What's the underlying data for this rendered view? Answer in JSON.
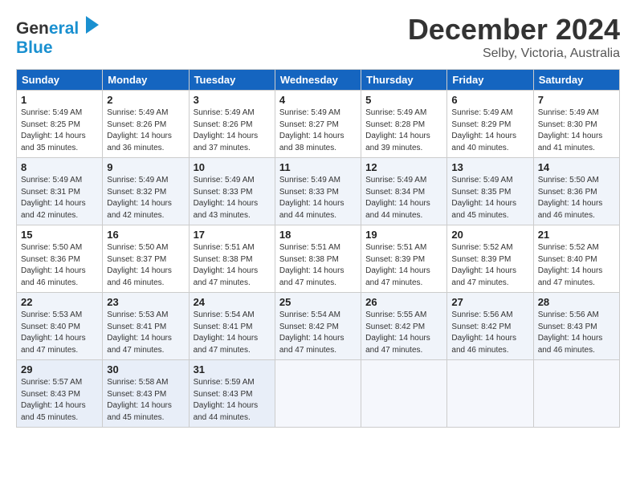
{
  "header": {
    "logo_line1": "General",
    "logo_line2": "Blue",
    "title": "December 2024",
    "subtitle": "Selby, Victoria, Australia"
  },
  "calendar": {
    "days_of_week": [
      "Sunday",
      "Monday",
      "Tuesday",
      "Wednesday",
      "Thursday",
      "Friday",
      "Saturday"
    ],
    "weeks": [
      [
        {
          "day": "1",
          "sunrise": "Sunrise: 5:49 AM",
          "sunset": "Sunset: 8:25 PM",
          "daylight": "Daylight: 14 hours and 35 minutes."
        },
        {
          "day": "2",
          "sunrise": "Sunrise: 5:49 AM",
          "sunset": "Sunset: 8:26 PM",
          "daylight": "Daylight: 14 hours and 36 minutes."
        },
        {
          "day": "3",
          "sunrise": "Sunrise: 5:49 AM",
          "sunset": "Sunset: 8:26 PM",
          "daylight": "Daylight: 14 hours and 37 minutes."
        },
        {
          "day": "4",
          "sunrise": "Sunrise: 5:49 AM",
          "sunset": "Sunset: 8:27 PM",
          "daylight": "Daylight: 14 hours and 38 minutes."
        },
        {
          "day": "5",
          "sunrise": "Sunrise: 5:49 AM",
          "sunset": "Sunset: 8:28 PM",
          "daylight": "Daylight: 14 hours and 39 minutes."
        },
        {
          "day": "6",
          "sunrise": "Sunrise: 5:49 AM",
          "sunset": "Sunset: 8:29 PM",
          "daylight": "Daylight: 14 hours and 40 minutes."
        },
        {
          "day": "7",
          "sunrise": "Sunrise: 5:49 AM",
          "sunset": "Sunset: 8:30 PM",
          "daylight": "Daylight: 14 hours and 41 minutes."
        }
      ],
      [
        {
          "day": "8",
          "sunrise": "Sunrise: 5:49 AM",
          "sunset": "Sunset: 8:31 PM",
          "daylight": "Daylight: 14 hours and 42 minutes."
        },
        {
          "day": "9",
          "sunrise": "Sunrise: 5:49 AM",
          "sunset": "Sunset: 8:32 PM",
          "daylight": "Daylight: 14 hours and 42 minutes."
        },
        {
          "day": "10",
          "sunrise": "Sunrise: 5:49 AM",
          "sunset": "Sunset: 8:33 PM",
          "daylight": "Daylight: 14 hours and 43 minutes."
        },
        {
          "day": "11",
          "sunrise": "Sunrise: 5:49 AM",
          "sunset": "Sunset: 8:33 PM",
          "daylight": "Daylight: 14 hours and 44 minutes."
        },
        {
          "day": "12",
          "sunrise": "Sunrise: 5:49 AM",
          "sunset": "Sunset: 8:34 PM",
          "daylight": "Daylight: 14 hours and 44 minutes."
        },
        {
          "day": "13",
          "sunrise": "Sunrise: 5:49 AM",
          "sunset": "Sunset: 8:35 PM",
          "daylight": "Daylight: 14 hours and 45 minutes."
        },
        {
          "day": "14",
          "sunrise": "Sunrise: 5:50 AM",
          "sunset": "Sunset: 8:36 PM",
          "daylight": "Daylight: 14 hours and 46 minutes."
        }
      ],
      [
        {
          "day": "15",
          "sunrise": "Sunrise: 5:50 AM",
          "sunset": "Sunset: 8:36 PM",
          "daylight": "Daylight: 14 hours and 46 minutes."
        },
        {
          "day": "16",
          "sunrise": "Sunrise: 5:50 AM",
          "sunset": "Sunset: 8:37 PM",
          "daylight": "Daylight: 14 hours and 46 minutes."
        },
        {
          "day": "17",
          "sunrise": "Sunrise: 5:51 AM",
          "sunset": "Sunset: 8:38 PM",
          "daylight": "Daylight: 14 hours and 47 minutes."
        },
        {
          "day": "18",
          "sunrise": "Sunrise: 5:51 AM",
          "sunset": "Sunset: 8:38 PM",
          "daylight": "Daylight: 14 hours and 47 minutes."
        },
        {
          "day": "19",
          "sunrise": "Sunrise: 5:51 AM",
          "sunset": "Sunset: 8:39 PM",
          "daylight": "Daylight: 14 hours and 47 minutes."
        },
        {
          "day": "20",
          "sunrise": "Sunrise: 5:52 AM",
          "sunset": "Sunset: 8:39 PM",
          "daylight": "Daylight: 14 hours and 47 minutes."
        },
        {
          "day": "21",
          "sunrise": "Sunrise: 5:52 AM",
          "sunset": "Sunset: 8:40 PM",
          "daylight": "Daylight: 14 hours and 47 minutes."
        }
      ],
      [
        {
          "day": "22",
          "sunrise": "Sunrise: 5:53 AM",
          "sunset": "Sunset: 8:40 PM",
          "daylight": "Daylight: 14 hours and 47 minutes."
        },
        {
          "day": "23",
          "sunrise": "Sunrise: 5:53 AM",
          "sunset": "Sunset: 8:41 PM",
          "daylight": "Daylight: 14 hours and 47 minutes."
        },
        {
          "day": "24",
          "sunrise": "Sunrise: 5:54 AM",
          "sunset": "Sunset: 8:41 PM",
          "daylight": "Daylight: 14 hours and 47 minutes."
        },
        {
          "day": "25",
          "sunrise": "Sunrise: 5:54 AM",
          "sunset": "Sunset: 8:42 PM",
          "daylight": "Daylight: 14 hours and 47 minutes."
        },
        {
          "day": "26",
          "sunrise": "Sunrise: 5:55 AM",
          "sunset": "Sunset: 8:42 PM",
          "daylight": "Daylight: 14 hours and 47 minutes."
        },
        {
          "day": "27",
          "sunrise": "Sunrise: 5:56 AM",
          "sunset": "Sunset: 8:42 PM",
          "daylight": "Daylight: 14 hours and 46 minutes."
        },
        {
          "day": "28",
          "sunrise": "Sunrise: 5:56 AM",
          "sunset": "Sunset: 8:43 PM",
          "daylight": "Daylight: 14 hours and 46 minutes."
        }
      ],
      [
        {
          "day": "29",
          "sunrise": "Sunrise: 5:57 AM",
          "sunset": "Sunset: 8:43 PM",
          "daylight": "Daylight: 14 hours and 45 minutes."
        },
        {
          "day": "30",
          "sunrise": "Sunrise: 5:58 AM",
          "sunset": "Sunset: 8:43 PM",
          "daylight": "Daylight: 14 hours and 45 minutes."
        },
        {
          "day": "31",
          "sunrise": "Sunrise: 5:59 AM",
          "sunset": "Sunset: 8:43 PM",
          "daylight": "Daylight: 14 hours and 44 minutes."
        },
        null,
        null,
        null,
        null
      ]
    ]
  }
}
